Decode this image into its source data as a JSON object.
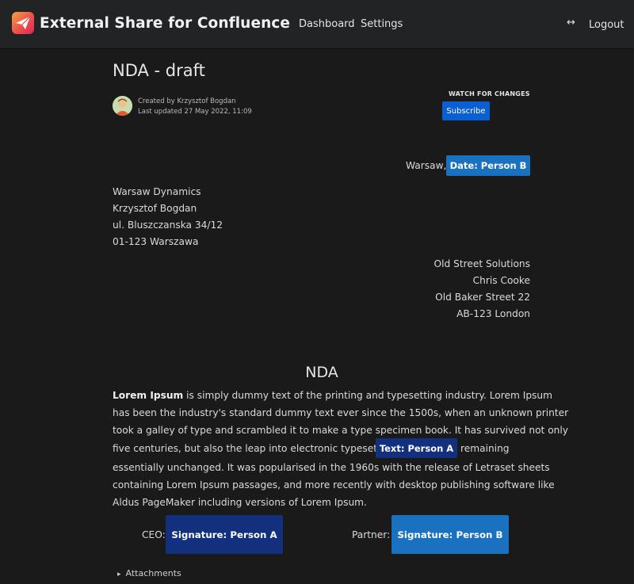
{
  "header": {
    "app_title": "External Share for Confluence",
    "nav": {
      "dashboard": "Dashboard",
      "settings": "Settings"
    },
    "swap_icon": "↔",
    "logout": "Logout",
    "logo_icon": "paper-plane-icon"
  },
  "page": {
    "title": "NDA - draft",
    "created_by": "Created by Krzysztof Bogdan",
    "last_updated": "Last updated 27 May 2022, 11:09",
    "watch_label": "WATCH FOR CHANGES",
    "subscribe_label": "Subscribe"
  },
  "document": {
    "place": "Warsaw,",
    "date_field": "Date: Person B",
    "sender": [
      "Warsaw Dynamics",
      "Krzysztof Bogdan",
      "ul. Bluszczanska 34/12",
      "01-123 Warszawa"
    ],
    "recipient": [
      "Old Street Solutions",
      "Chris Cooke",
      "Old Baker Street 22",
      "AB-123 London"
    ],
    "heading": "NDA",
    "para": {
      "l1_bold": "Lorem Ipsum",
      "l1_rest": " is simply dummy text of the printing and typesetting industry. Lorem Ipsum",
      "l2": "has been the industry's standard dummy text ever since the 1500s, when an unknown printer",
      "l3": "took a galley of type and scrambled it to make a type specimen book. It has survived not only",
      "l4": "five centuries, but also the leap into electronic typesetting,",
      "text_field": "Text: Person A",
      "l4_after": "remaining",
      "l5": "essentially unchanged. It was popularised in the 1960s with the release of Letraset sheets",
      "l6": "containing Lorem Ipsum passages, and more recently with desktop publishing software like",
      "l7": "Aldus PageMaker including versions of Lorem Ipsum."
    },
    "signatures": {
      "ceo_label": "CEO:",
      "ceo_field": "Signature: Person A",
      "partner_label": "Partner:",
      "partner_field": "Signature: Person B"
    },
    "attachments": "Attachments"
  },
  "colors": {
    "accent_blue": "#0b5fd1",
    "person_a": "#12307e",
    "person_b": "#1a71bf"
  }
}
